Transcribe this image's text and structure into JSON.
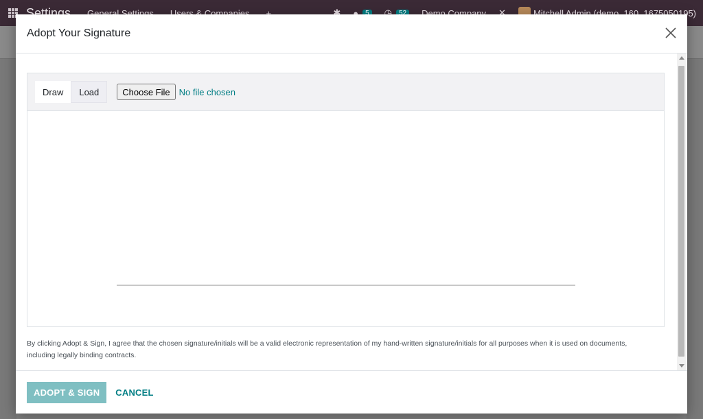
{
  "background": {
    "brand": "Settings",
    "nav_items": [
      "General Settings",
      "Users & Companies"
    ],
    "chat_badge": "5",
    "activity_badge": "52",
    "company": "Demo Company",
    "user": "Mitchell Admin (demo_160_1675050195)"
  },
  "dialog": {
    "title": "Adopt Your Signature",
    "tabs": [
      {
        "label": "Draw",
        "active": true
      },
      {
        "label": "Load",
        "active": false
      }
    ],
    "file_button_label": "Choose File",
    "file_status": "No file chosen",
    "legal_text": "By clicking Adopt & Sign, I agree that the chosen signature/initials will be a valid electronic representation of my hand-written signature/initials for all purposes when it is used on documents, including legally binding contracts.",
    "adopt_button_label": "ADOPT & SIGN",
    "cancel_button_label": "CANCEL"
  },
  "colors": {
    "accent": "#017e84",
    "primary_disabled": "#7fbfc2",
    "navbar": "#3b2a36"
  }
}
